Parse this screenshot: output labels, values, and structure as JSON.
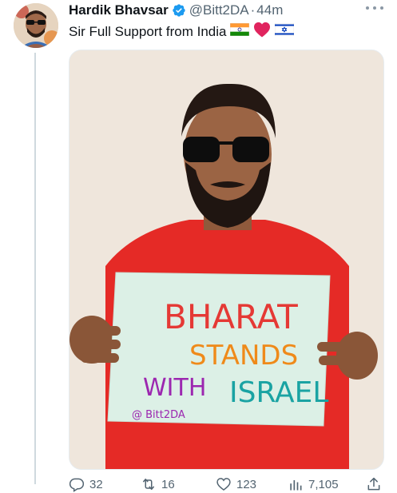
{
  "tweet": {
    "author_name": "Hardik Bhavsar",
    "handle": "@Bitt2DA",
    "separator": "·",
    "time": "44m",
    "text": "Sir Full Support from India",
    "emojis": [
      "india-flag-icon",
      "red-heart-icon",
      "israel-flag-icon"
    ]
  },
  "media": {
    "sign_lines": [
      "BHARAT",
      "STANDS",
      "WITH",
      "ISRAEL"
    ],
    "sign_credit": "@ Bitt2DA"
  },
  "actions": {
    "replies": "32",
    "retweets": "16",
    "likes": "123",
    "views": "7,105"
  },
  "colors": {
    "text_primary": "#0f1419",
    "text_secondary": "#536471",
    "verified_blue": "#1d9bf0",
    "thread_line": "#cfd9de"
  }
}
